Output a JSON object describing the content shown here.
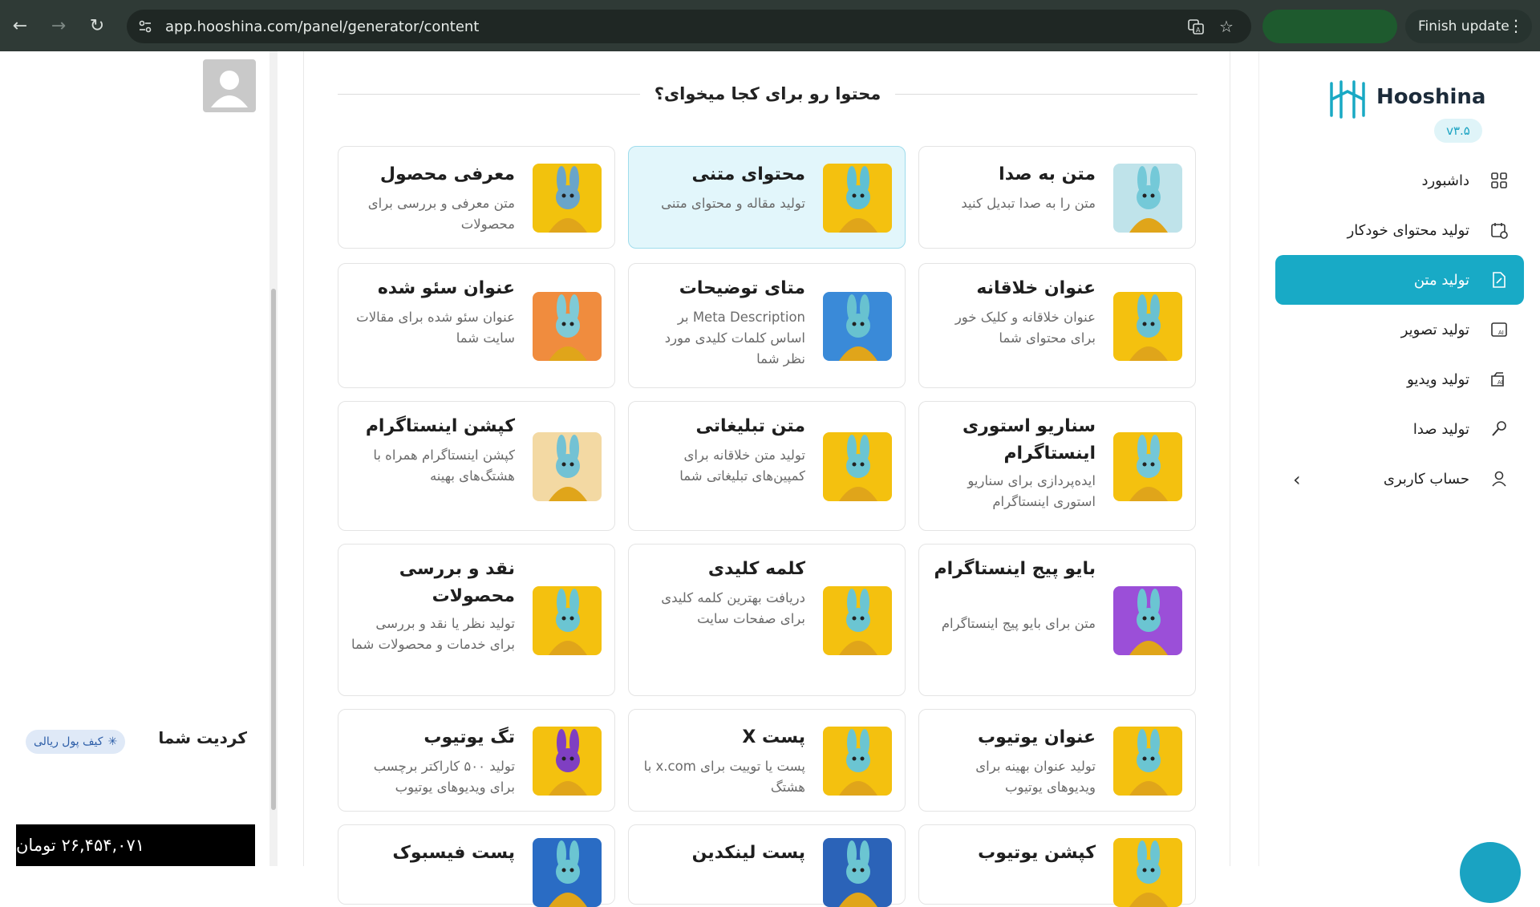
{
  "browser": {
    "url": "app.hooshina.com/panel/generator/content",
    "finish_label": "Finish update"
  },
  "left": {
    "credit_title": "کردیت شما",
    "wallet_label": "کیف پول ریالی",
    "credit_amount": "۲۶,۴۵۴,۰۷۱ تومان"
  },
  "main": {
    "heading": "محتوا رو برای کجا میخوای؟",
    "cards": [
      {
        "title": "معرفی محصول",
        "desc": "متن معرفی و بررسی برای محصولات"
      },
      {
        "title": "محتوای متنی",
        "desc": "تولید مقاله و محتوای متنی"
      },
      {
        "title": "متن به صدا",
        "desc": "متن را به صدا تبدیل کنید"
      },
      {
        "title": "عنوان سئو شده",
        "desc": "عنوان سئو شده برای مقالات سایت شما"
      },
      {
        "title": "متای توضیحات",
        "desc": "Meta Description بر اساس کلمات کلیدی مورد نظر شما"
      },
      {
        "title": "عنوان خلاقانه",
        "desc": "عنوان خلاقانه و کلیک خور برای محتوای شما"
      },
      {
        "title": "کپشن اینستاگرام",
        "desc": "کپشن اینستاگرام همراه با هشتگ‌های بهینه"
      },
      {
        "title": "متن تبلیغاتی",
        "desc": "تولید متن خلاقانه برای کمپین‌های تبلیغاتی شما"
      },
      {
        "title": "سناریو استوری اینستاگرام",
        "desc": "ایده‌پردازی برای سناریو استوری اینستاگرام"
      },
      {
        "title": "نقد و بررسی محصولات",
        "desc": "تولید نظر یا نقد و بررسی برای خدمات و محصولات شما"
      },
      {
        "title": "کلمه کلیدی",
        "desc": "دریافت بهترین کلمه کلیدی برای صفحات سایت"
      },
      {
        "title": "بایو پیج اینستاگرام",
        "desc": "متن برای بایو پیج اینستاگرام"
      },
      {
        "title": "تگ یوتیوب",
        "desc": "تولید ۵۰۰ کاراکتر برچسب برای ویدیوهای یوتیوب"
      },
      {
        "title": "پست X",
        "desc": "پست یا توییت برای x.com با هشتگ"
      },
      {
        "title": "عنوان یوتیوب",
        "desc": "تولید عنوان بهینه برای ویدیوهای یوتیوب"
      },
      {
        "title": "پست فیسبوک",
        "desc": ""
      },
      {
        "title": "پست لینکدین",
        "desc": ""
      },
      {
        "title": "کپشن یوتیوب",
        "desc": ""
      }
    ]
  },
  "right": {
    "brand": "Hooshina",
    "version": "v۳.۵",
    "menu": [
      {
        "label": "داشبورد",
        "icon": "dashboard-icon"
      },
      {
        "label": "تولید محتوای خودکار",
        "icon": "calendar-clock-icon"
      },
      {
        "label": "تولید متن",
        "icon": "document-edit-icon"
      },
      {
        "label": "تولید تصویر",
        "icon": "ai-image-icon"
      },
      {
        "label": "تولید ویدیو",
        "icon": "ai-video-icon"
      },
      {
        "label": "تولید صدا",
        "icon": "microphone-icon"
      },
      {
        "label": "حساب کاربری",
        "icon": "user-icon"
      }
    ]
  },
  "colors": {
    "accent": "#18aac6",
    "active_card_bg": "#e2f6fb",
    "chrome_bg": "#2f3a36"
  }
}
